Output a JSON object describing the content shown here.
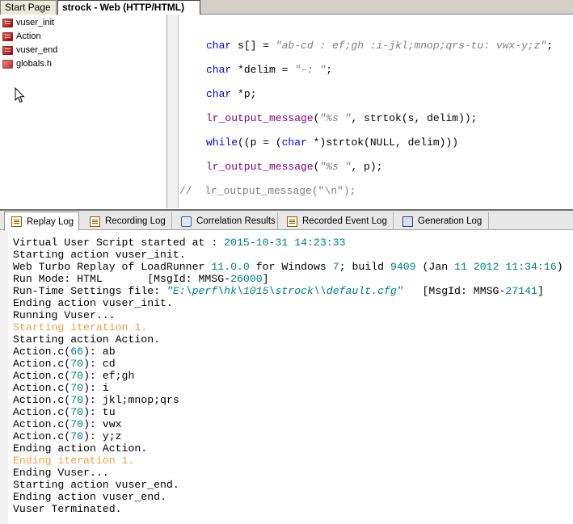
{
  "doc_tabs": {
    "start_page": "Start Page",
    "script_tab": "strock - Web (HTTP/HTML)"
  },
  "tree": {
    "items": [
      {
        "label": "vuser_init",
        "icon": "script-icon"
      },
      {
        "label": "Action",
        "icon": "script-icon"
      },
      {
        "label": "vuser_end",
        "icon": "script-icon"
      },
      {
        "label": "globals.h",
        "icon": "header-file-icon"
      }
    ]
  },
  "editor": {
    "lines": [
      {
        "p1": "char",
        "p2": " s[] = ",
        "p3": "\"ab-cd : ef;gh :i-jkl;mnop;qrs-tu: vwx-y;z\"",
        "p4": ";"
      },
      {
        "p1": "char",
        "p2": " *delim = ",
        "p3": "\"-: \"",
        "p4": ";"
      },
      {
        "p1": "char",
        "p2": " *p;",
        "p3": "",
        "p4": ""
      },
      {
        "p1": "lr_output_message",
        "p2": "(",
        "p3": "\"%s \"",
        "p4": ", strtok(s, delim));"
      },
      {
        "p1": "while",
        "p2": "((p = (",
        "p3": "char",
        "p4": " *)strtok(NULL, delim)))"
      },
      {
        "p1": "lr_output_message",
        "p2": "(",
        "p3": "\"%s \"",
        "p4": ", p);"
      },
      {
        "comment": "//  lr_output_message(\"\\n\");"
      }
    ]
  },
  "log_tabs": [
    {
      "label": "Replay Log",
      "icon": "doc-icon",
      "active": true
    },
    {
      "label": "Recording Log",
      "icon": "doc-icon"
    },
    {
      "label": "Correlation Results",
      "icon": "correlation-icon"
    },
    {
      "label": "Recorded Event Log",
      "icon": "doc-icon"
    },
    {
      "label": "Generation Log",
      "icon": "generation-icon"
    }
  ],
  "log": {
    "l0a": "Virtual User Script started at : ",
    "l0b": "2015-10-31 14:23:33",
    "l1": "Starting action vuser_init.",
    "l2a": "Web Turbo Replay of LoadRunner ",
    "l2b": "11.0.0",
    "l2c": " for Windows ",
    "l2d": "7",
    "l2e": "; build ",
    "l2f": "9409",
    "l2g": " (Jan ",
    "l2h": "11",
    "l2i": " ",
    "l2j": "2012",
    "l2k": " ",
    "l2l": "11:34:16",
    "l2m": ")",
    "l3a": "Run Mode: HTML       [MsgId: MMSG-",
    "l3b": "26000",
    "l3c": "]",
    "l4a": "Run-Time Settings file: ",
    "l4b": "\"E:\\perf\\hk\\1015\\strock\\\\default.cfg\"",
    "l4c": "   [MsgId: MMSG-",
    "l4d": "27141",
    "l4e": "]",
    "l5": "Ending action vuser_init.",
    "l6": "Running Vuser...",
    "l7": "Starting iteration 1.",
    "l8": "Starting action Action.",
    "out": [
      {
        "pre": "Action.c(",
        "n": "66",
        "post": "): ab"
      },
      {
        "pre": "Action.c(",
        "n": "70",
        "post": "): cd"
      },
      {
        "pre": "Action.c(",
        "n": "70",
        "post": "): ef;gh"
      },
      {
        "pre": "Action.c(",
        "n": "70",
        "post": "): i"
      },
      {
        "pre": "Action.c(",
        "n": "70",
        "post": "): jkl;mnop;qrs"
      },
      {
        "pre": "Action.c(",
        "n": "70",
        "post": "): tu"
      },
      {
        "pre": "Action.c(",
        "n": "70",
        "post": "): vwx"
      },
      {
        "pre": "Action.c(",
        "n": "70",
        "post": "): y;z"
      }
    ],
    "l17": "Ending action Action.",
    "l18": "Ending iteration 1.",
    "l19": "Ending Vuser...",
    "l20": "Starting action vuser_end.",
    "l21": "Ending action vuser_end.",
    "l22": "Vuser Terminated."
  }
}
